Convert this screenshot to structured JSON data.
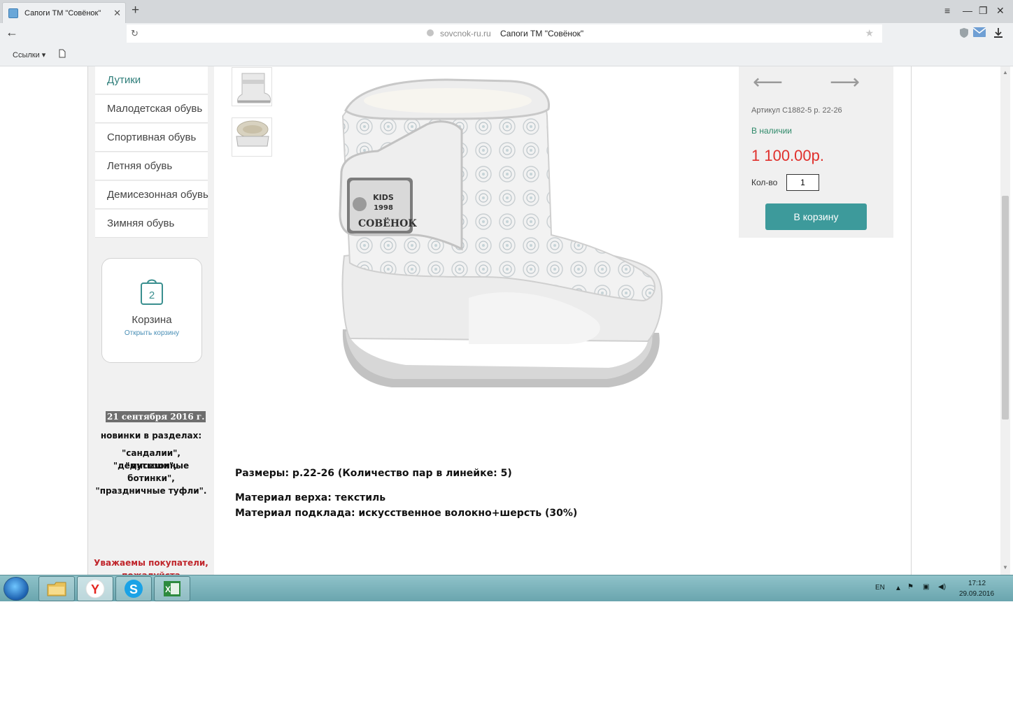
{
  "browser": {
    "tab_title": "Сапоги ТМ \"Совёнок\"",
    "tab_close": "✕",
    "new_tab": "+",
    "window_controls": [
      "≡",
      "—",
      "❐",
      "✕"
    ],
    "back": "←",
    "reload": "↻",
    "address_domain": "sovcnok-ru.ru",
    "address_title": "Сапоги ТМ \"Совёнок\"",
    "bookmark_star": "★",
    "bookmarks_links": "Ссылки ▾",
    "bookmark_page_icon": "page-icon",
    "right_icons": [
      "shield-icon",
      "mail-icon",
      "download-icon"
    ]
  },
  "sidebar": {
    "menu": [
      {
        "label": "Дутики"
      },
      {
        "label": "Малодетская обувь"
      },
      {
        "label": "Спортивная обувь"
      },
      {
        "label": "Летняя обувь"
      },
      {
        "label": "Демисезонная обувь"
      },
      {
        "label": "Зимняя обувь"
      }
    ],
    "cart": {
      "count": "2",
      "label": "Корзина",
      "open_link": "Открыть корзину"
    },
    "news": {
      "date": "21 сентября 2016 г.",
      "heading": "новинки в разделах:",
      "line1": "\"сандалии\", \"дутыши\",",
      "line2": "\"демисезонные",
      "line3": "ботинки\",",
      "line4": "\"праздничные туфли\"."
    },
    "notice_line1": "Уважаемы покупатели,",
    "notice_line2": "пожалуйста"
  },
  "product": {
    "specs": {
      "sizes": "Размеры: р.22-26 (Количество пар в линейке: 5)",
      "upper": "Материал верха: текстиль",
      "lining": "Материал подклада: искусственное волокно+шерсть (30%)"
    },
    "image_brand_kids": "KIDS",
    "image_brand_year": "1998",
    "image_brand_name": "СОВЁНОК"
  },
  "buybox": {
    "prev": "⟵",
    "next": "⟶",
    "sku": "Артикул С1882-5 р. 22-26",
    "stock": "В наличии",
    "price": "1 100.00р.",
    "qty_label": "Кол-во",
    "qty_value": "1",
    "button": "В корзину"
  },
  "taskbar": {
    "lang": "EN",
    "time": "17:12",
    "date": "29.09.2016",
    "apps": [
      "explorer-icon",
      "yandex-browser-icon",
      "skype-icon",
      "excel-icon"
    ]
  },
  "colors": {
    "accent": "#3d9a9b",
    "price": "#e0302c",
    "stock": "#2f8a6a",
    "notice": "#c0262c"
  }
}
